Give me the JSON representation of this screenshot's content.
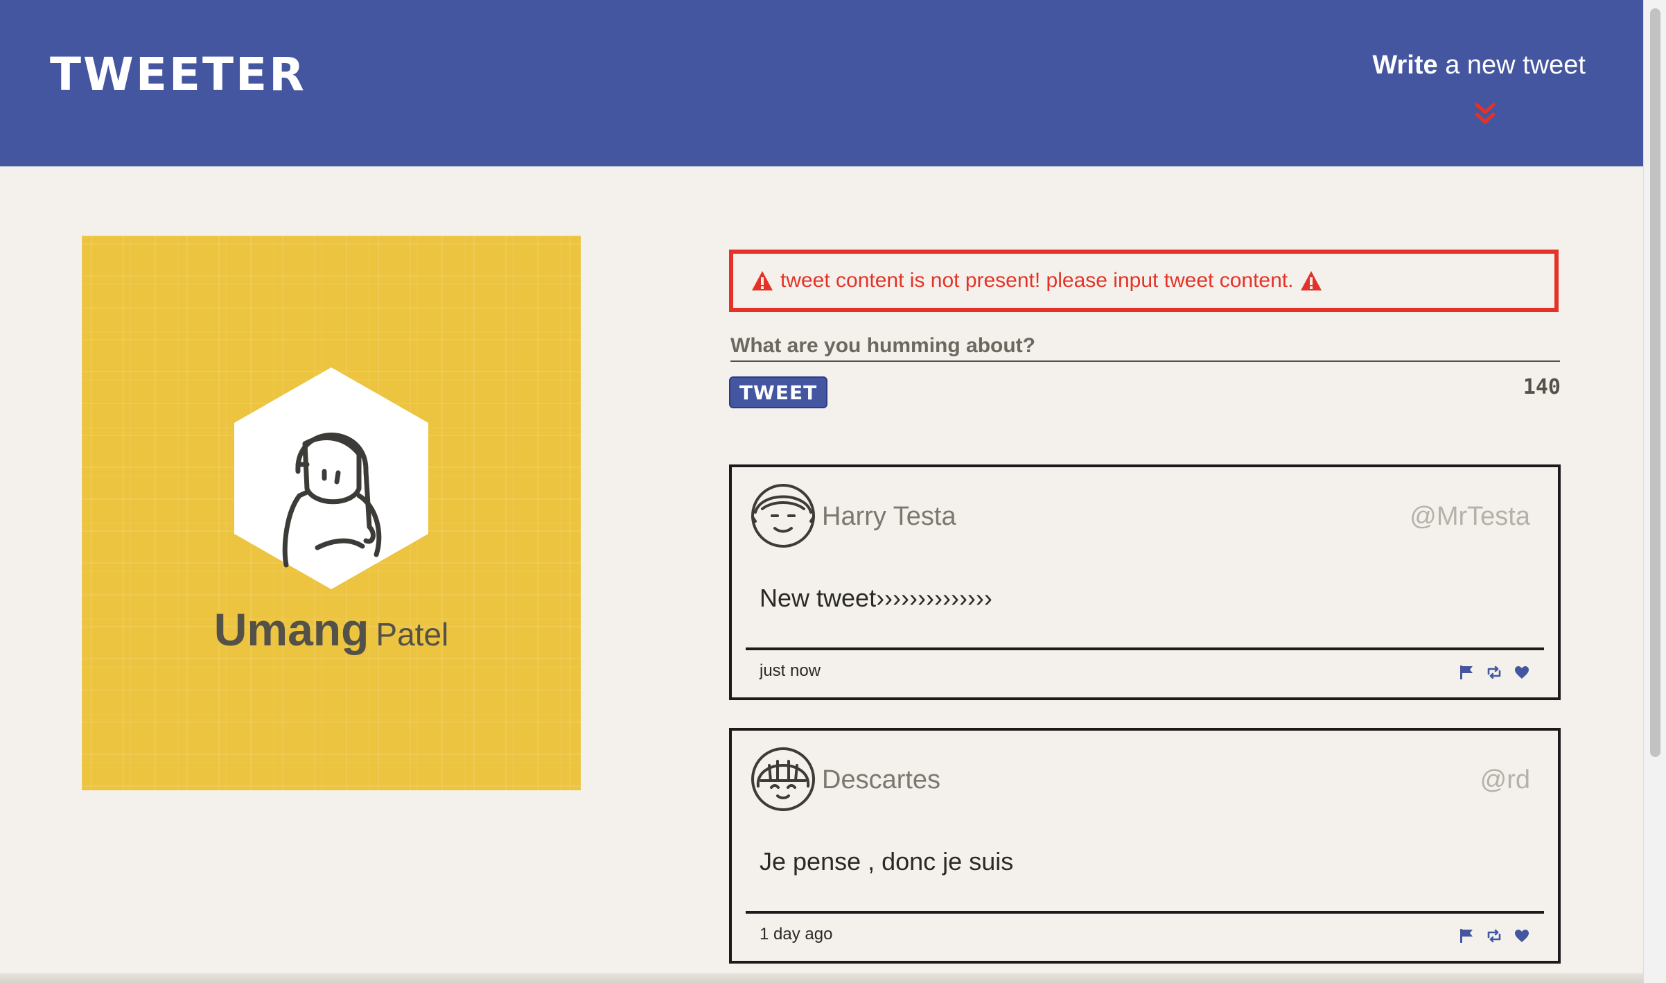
{
  "nav": {
    "brand": "TWEETER",
    "compose_bold": "Write",
    "compose_rest": "a new tweet",
    "chevron_icon": "double-chevron-down-icon",
    "bg_color": "#4456a0",
    "accent_color": "#e53227"
  },
  "profile": {
    "first_name": "Umang",
    "last_name": "Patel",
    "bg_color": "#ecc43f"
  },
  "compose": {
    "error_message": "tweet content is not present! please input tweet content.",
    "error_icon": "warning-icon",
    "placeholder": "What are you humming about?",
    "button_label": "TWEET",
    "char_count": "140"
  },
  "tweets": [
    {
      "author": "Harry Testa",
      "handle": "@MrTesta",
      "content": "New tweet››››››››››››››",
      "time": "just now"
    },
    {
      "author": "Descartes",
      "handle": "@rd",
      "content": "Je pense , donc je suis",
      "time": "1 day ago"
    }
  ]
}
